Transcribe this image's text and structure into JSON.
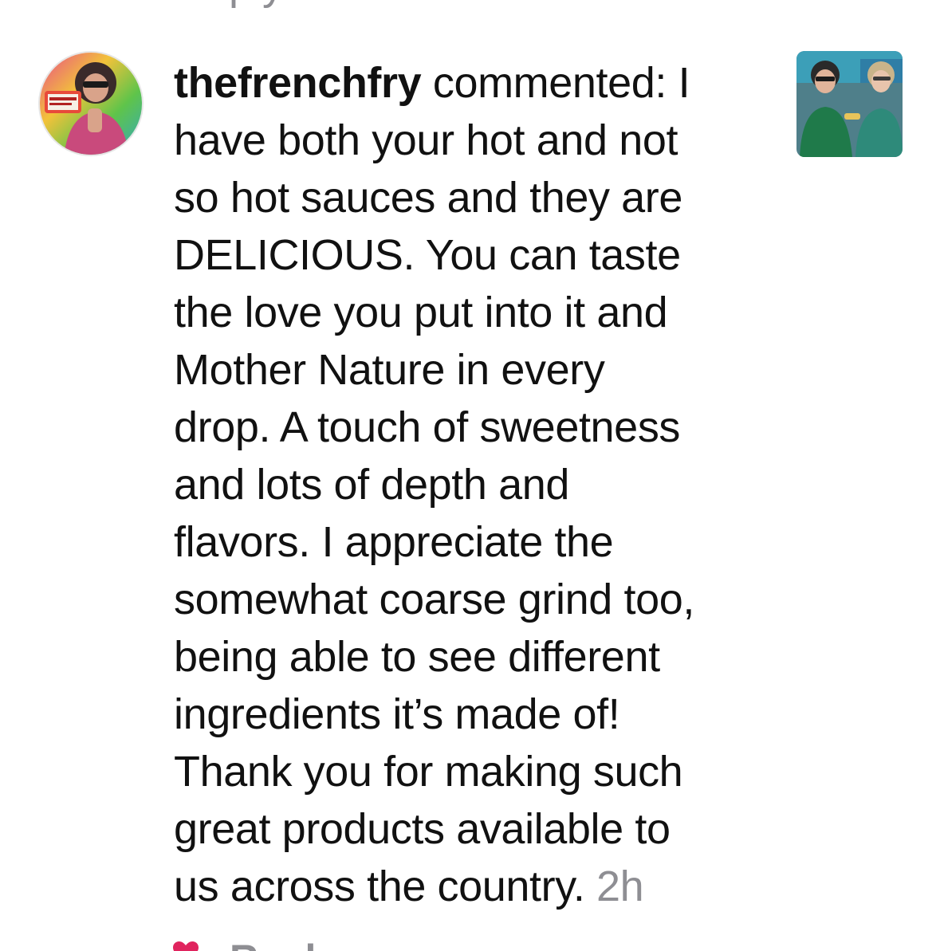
{
  "above": {
    "cut_text": "Reply"
  },
  "comment": {
    "username": "thefrenchfry",
    "lines": [
      " commented: I",
      "have both your hot and not",
      "so hot sauces and they are",
      "DELICIOUS. You can taste",
      "the love you put into it and",
      "Mother Nature in every",
      "drop. A touch of sweetness",
      "and lots of depth and",
      "flavors. I appreciate the",
      "somewhat coarse grind too,",
      "being able to see different",
      "ingredients it’s made of!",
      "Thank you for making such",
      "great products available to",
      "us across the country. "
    ],
    "time": "2h"
  },
  "actions": {
    "reply_label": "Reply",
    "heart_icon": "heart-icon"
  },
  "colors": {
    "text": "#111111",
    "muted": "#8e8e93",
    "heart": "#e0245e"
  }
}
